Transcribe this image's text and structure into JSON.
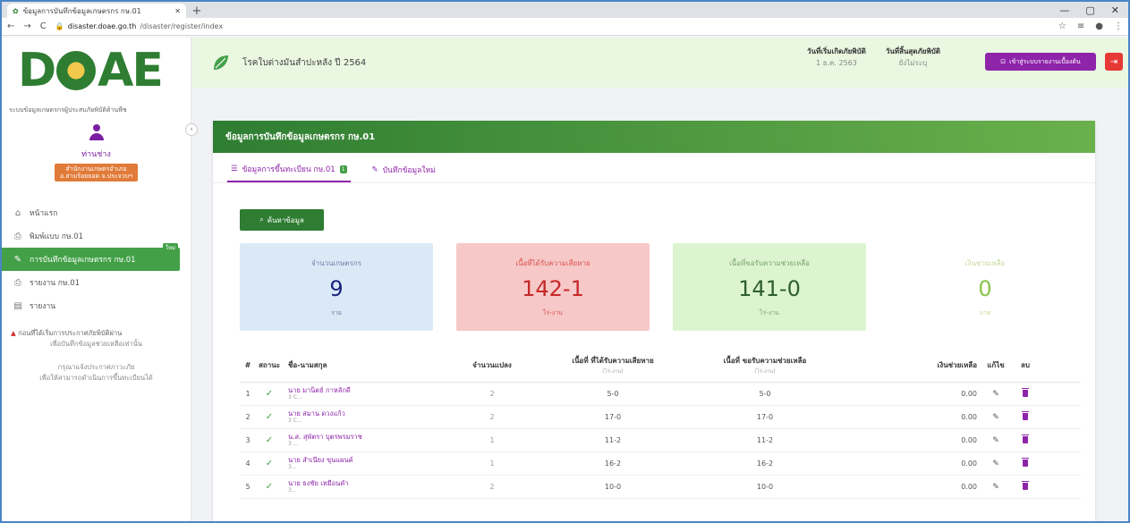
{
  "browser": {
    "tab_title": "ข้อมูลการบันทึกข้อมูลเกษตรกร กษ.01",
    "url_host": "disaster.doae.go.th",
    "url_path": "/disaster/register/index",
    "window_controls": [
      "—",
      "▢",
      "✕"
    ]
  },
  "sidebar": {
    "logo": {
      "left": "D",
      "right": "AE"
    },
    "system_title": "ระบบข้อมูลเกษตรกรผู้ประสบภัยพิบัติด้านพืช",
    "user": {
      "name": "ท่านช่าง",
      "role_line1": "สำนักงานเกษตรอำเภอ",
      "role_line2": "อ.สามร้อยยอด จ.ประจวบฯ"
    },
    "items": [
      {
        "label": "หน้าแรก",
        "icon": "home-icon"
      },
      {
        "label": "พิมพ์แบบ กษ.01",
        "icon": "print-icon"
      },
      {
        "label": "การบันทึกข้อมูลเกษตรกร กษ.01",
        "icon": "pencil-icon",
        "badge": "ใหม่"
      },
      {
        "label": "รายงาน กษ.01",
        "icon": "print-icon"
      },
      {
        "label": "รายงาน",
        "icon": "report-icon"
      }
    ],
    "notice": {
      "line1": "ก่อนที่ได้เริ่มการประกาศภัยพิบัติผ่าน",
      "line2": "เพื่อบันทึกข้อมูลช่วยเหลือเท่านั้น",
      "line3": "กรุณาแจ้งประกาศภาวะภัย",
      "line4": "เพื่อให้สามารถดำเนินการขึ้นทะเบียนได้"
    }
  },
  "topbar": {
    "project": "โรคใบด่างมันสำปะหลัง ปี 2564",
    "start_label": "วันที่เริ่มเกิดภัยพิบัติ",
    "start_value": "1 ธ.ค. 2563",
    "end_label": "วันที่สิ้นสุดภัยพิบัติ",
    "end_value": "ยังไม่ระบุ",
    "manual_label": "เข้าสู่ระบบรายงานเบื้องต้น"
  },
  "card": {
    "title": "ข้อมูลการบันทึกข้อมูลเกษตรกร กษ.01",
    "tabs": [
      {
        "label": "ข้อมูลการขึ้นทะเบียน กษ.01",
        "badge": "1"
      },
      {
        "label": "บันทึกข้อมูลใหม่"
      }
    ],
    "search_label": "ค้นหาข้อมูล",
    "stats": [
      {
        "label": "จำนวนเกษตรกร",
        "value": "9",
        "unit": "ราย"
      },
      {
        "label": "เนื้อที่ได้รับความเสียหาย",
        "value": "142-1",
        "unit": "ไร่-งาน"
      },
      {
        "label": "เนื้อที่ขอรับความช่วยเหลือ",
        "value": "141-0",
        "unit": "ไร่-งาน"
      },
      {
        "label": "เงินช่วยเหลือ",
        "value": "0",
        "unit": "บาท"
      }
    ],
    "table": {
      "headers": {
        "idx": "#",
        "status": "สถานะ",
        "name": "ชื่อ-นามสกุล",
        "plots": "จำนวนแปลง",
        "area": "เนื้อที่ ที่ได้รับความเสียหาย",
        "area_unit": "(ไร่-งาน)",
        "help": "เนื้อที่ ขอรับความช่วยเหลือ",
        "help_unit": "(ไร่-งาน)",
        "money": "เงินช่วยเหลือ",
        "edit": "แก้ไข",
        "del": "ลบ"
      },
      "rows": [
        {
          "idx": "1",
          "name": "นาย มานิตย์ กาหลักดี",
          "sub": "3 C...",
          "plots": "2",
          "area": "5-0",
          "help": "5-0",
          "money": "0.00"
        },
        {
          "idx": "2",
          "name": "นาย สมาน ดวงแก้ว",
          "sub": "3 C...",
          "plots": "2",
          "area": "17-0",
          "help": "17-0",
          "money": "0.00"
        },
        {
          "idx": "3",
          "name": "น.ส. สุพัตรา บุตรพรมราช",
          "sub": "3 ...",
          "plots": "1",
          "area": "11-2",
          "help": "11-2",
          "money": "0.00"
        },
        {
          "idx": "4",
          "name": "นาย สำเนียง ขุนแผนค์",
          "sub": "3...",
          "plots": "1",
          "area": "16-2",
          "help": "16-2",
          "money": "0.00"
        },
        {
          "idx": "5",
          "name": "นาย ธงชัย เหมือนคำ",
          "sub": "3...",
          "plots": "2",
          "area": "10-0",
          "help": "10-0",
          "money": "0.00"
        }
      ]
    }
  }
}
